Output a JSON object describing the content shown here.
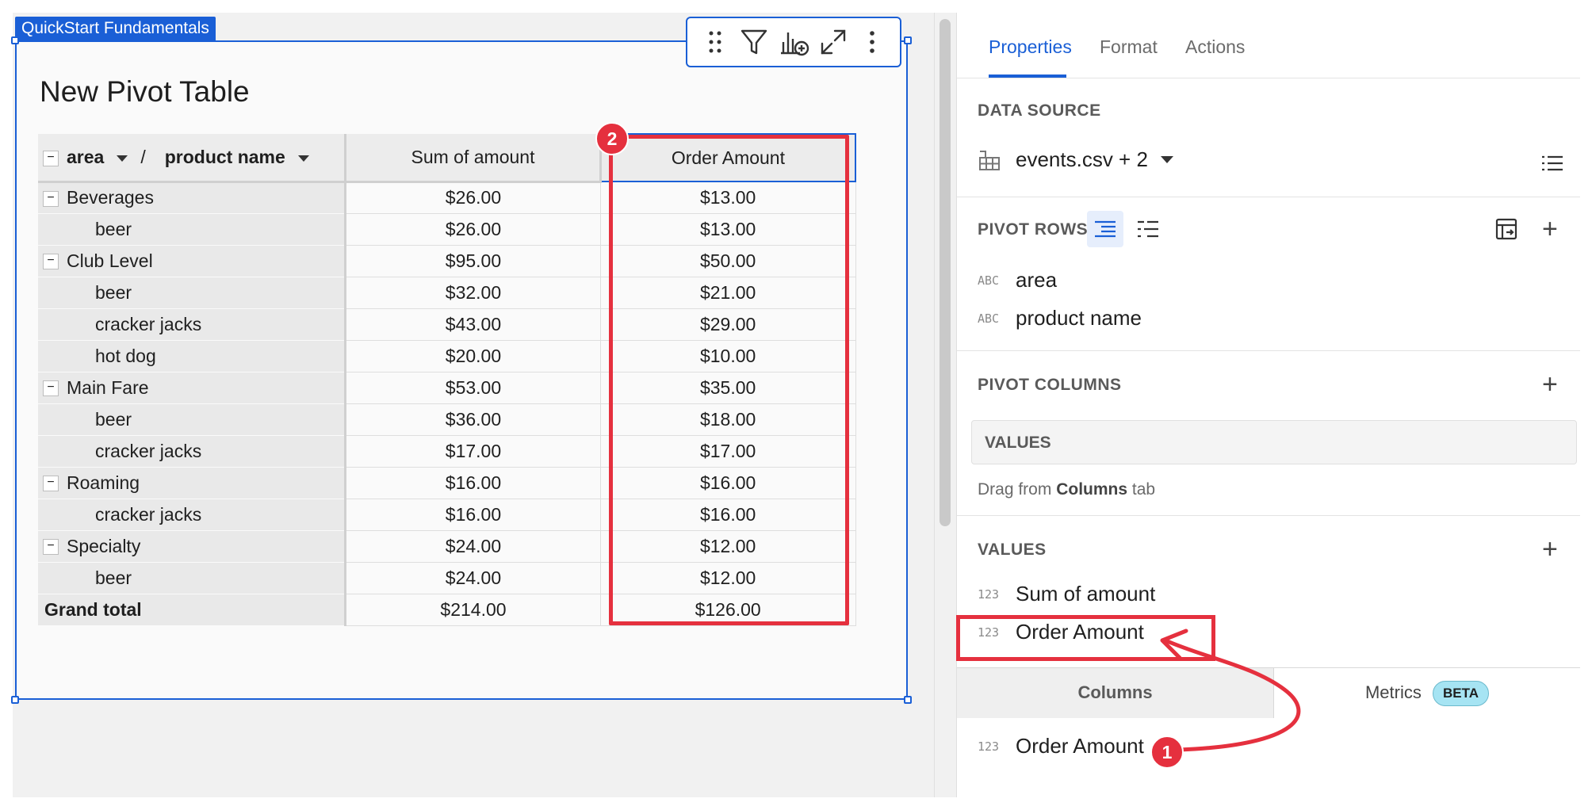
{
  "page_tag": "QuickStart Fundamentals",
  "element_title": "New Pivot Table",
  "toolbar": {
    "icons": [
      "drag-handle-icon",
      "filter-icon",
      "add-chart-icon",
      "expand-icon",
      "more-icon"
    ]
  },
  "pivot": {
    "row_header_1": "area",
    "row_header_sep": "/",
    "row_header_2": "product name",
    "col_sum": "Sum of amount",
    "col_order": "Order Amount",
    "rows": [
      {
        "label": "Beverages",
        "level": 0,
        "sum": "$26.00",
        "order": "$13.00"
      },
      {
        "label": "beer",
        "level": 1,
        "sum": "$26.00",
        "order": "$13.00"
      },
      {
        "label": "Club Level",
        "level": 0,
        "sum": "$95.00",
        "order": "$50.00"
      },
      {
        "label": "beer",
        "level": 1,
        "sum": "$32.00",
        "order": "$21.00"
      },
      {
        "label": "cracker jacks",
        "level": 1,
        "sum": "$43.00",
        "order": "$29.00"
      },
      {
        "label": "hot dog",
        "level": 1,
        "sum": "$20.00",
        "order": "$10.00"
      },
      {
        "label": "Main Fare",
        "level": 0,
        "sum": "$53.00",
        "order": "$35.00"
      },
      {
        "label": "beer",
        "level": 1,
        "sum": "$36.00",
        "order": "$18.00"
      },
      {
        "label": "cracker jacks",
        "level": 1,
        "sum": "$17.00",
        "order": "$17.00"
      },
      {
        "label": "Roaming",
        "level": 0,
        "sum": "$16.00",
        "order": "$16.00"
      },
      {
        "label": "cracker jacks",
        "level": 1,
        "sum": "$16.00",
        "order": "$16.00"
      },
      {
        "label": "Specialty",
        "level": 0,
        "sum": "$24.00",
        "order": "$12.00"
      },
      {
        "label": "beer",
        "level": 1,
        "sum": "$24.00",
        "order": "$12.00"
      }
    ],
    "grand_total_label": "Grand total",
    "grand_total_sum": "$214.00",
    "grand_total_order": "$126.00"
  },
  "annotations": {
    "badge_1": "1",
    "badge_2": "2"
  },
  "panel": {
    "tabs": [
      "Properties",
      "Format",
      "Actions"
    ],
    "data_source_label": "DATA SOURCE",
    "data_source_value": "events.csv + 2",
    "pivot_rows_label": "PIVOT ROWS",
    "pivot_rows": [
      {
        "type": "ABC",
        "name": "area"
      },
      {
        "type": "ABC",
        "name": "product name"
      }
    ],
    "pivot_columns_label": "PIVOT COLUMNS",
    "values_placeholder": "VALUES",
    "hint_prefix": "Drag from",
    "hint_bold": "Columns",
    "hint_suffix": "tab",
    "values_label": "VALUES",
    "values": [
      {
        "type": "123",
        "name": "Sum of amount"
      },
      {
        "type": "123",
        "name": "Order Amount"
      }
    ],
    "subtab_columns": "Columns",
    "subtab_metrics": "Metrics",
    "beta": "BETA",
    "column_item": {
      "type": "123",
      "name": "Order Amount"
    }
  },
  "colors": {
    "accent": "#1a5fd6",
    "annotation": "#e5303e",
    "beta_bg": "#a6e4f3"
  }
}
